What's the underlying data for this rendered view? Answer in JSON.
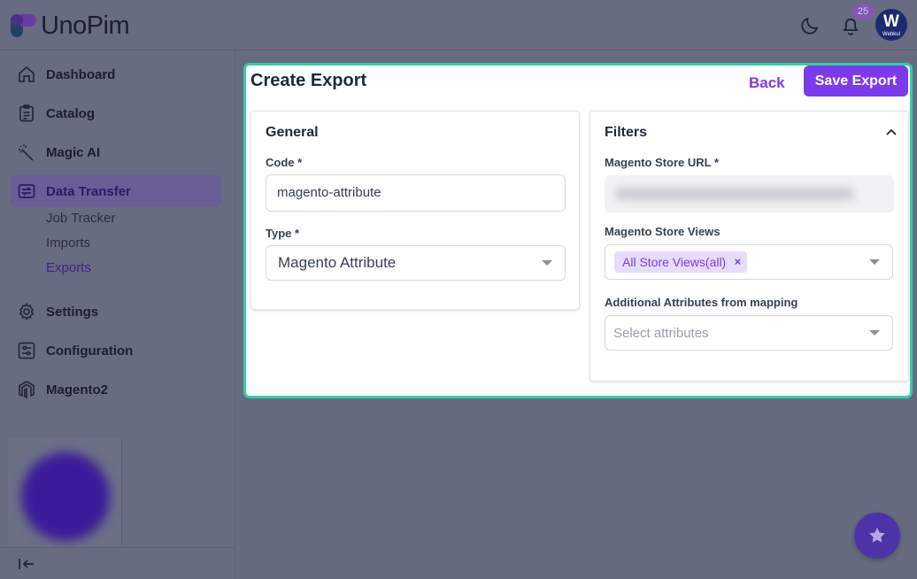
{
  "app": {
    "name": "UnoPim",
    "notifications_count": "25",
    "avatar_initial": "W",
    "avatar_caption": "Webkul"
  },
  "sidebar": {
    "items": [
      {
        "label": "Dashboard",
        "icon": "home-icon"
      },
      {
        "label": "Catalog",
        "icon": "clipboard-icon"
      },
      {
        "label": "Magic AI",
        "icon": "magic-wand-icon"
      },
      {
        "label": "Data Transfer",
        "icon": "data-transfer-icon",
        "active": true
      },
      {
        "label": "Settings",
        "icon": "gear-icon"
      },
      {
        "label": "Configuration",
        "icon": "sliders-icon"
      },
      {
        "label": "Magento2",
        "icon": "magento-icon"
      }
    ],
    "subitems": [
      "Job Tracker",
      "Imports",
      "Exports"
    ]
  },
  "page": {
    "title": "Create Export",
    "back_label": "Back",
    "save_label": "Save Export"
  },
  "general": {
    "title": "General",
    "code_label": "Code *",
    "code_value": "magento-attribute",
    "type_label": "Type *",
    "type_value": "Magento Attribute"
  },
  "filters": {
    "title": "Filters",
    "store_url_label": "Magento Store URL *",
    "store_views_label": "Magento Store Views",
    "store_views_tag": "All Store Views(all)",
    "tag_remove": "×",
    "additional_label": "Additional Attributes from mapping",
    "additional_placeholder": "Select attributes"
  },
  "colors": {
    "accent": "#7c3aed",
    "panel_border": "#2fd1a3"
  }
}
